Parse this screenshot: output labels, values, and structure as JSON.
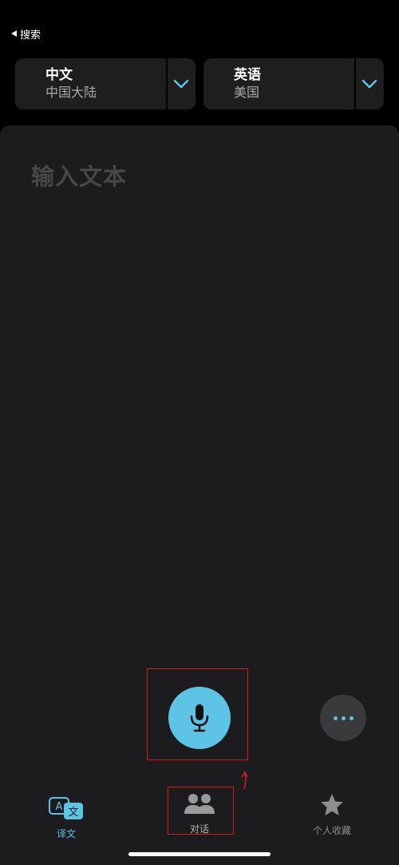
{
  "topbar": {
    "back_label": "搜索"
  },
  "source_lang": {
    "name": "中文",
    "region": "中国大陆"
  },
  "target_lang": {
    "name": "英语",
    "region": "美国"
  },
  "input": {
    "placeholder": "输入文本"
  },
  "tabs": [
    {
      "label": "译文",
      "icon": "translate-icon",
      "active": true
    },
    {
      "label": "对话",
      "icon": "conversation-icon",
      "active": false
    },
    {
      "label": "个人收藏",
      "icon": "star-icon",
      "active": false
    }
  ],
  "colors": {
    "accent": "#5ec4e5",
    "panel": "#1c1c1e",
    "highlight": "#d51d1d"
  }
}
